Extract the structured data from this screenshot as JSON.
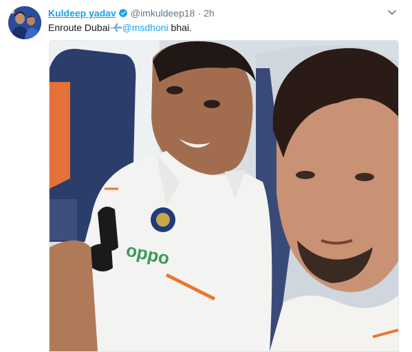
{
  "tweet": {
    "author_name": "Kuldeep yadav",
    "handle": "@imkuldeep18",
    "separator": "·",
    "time": "2h",
    "text_before": "Enroute Dubai",
    "mention": "@msdhoni",
    "text_after": " bhai.",
    "icons": {
      "verified": "verified-badge-icon",
      "caret": "chevron-down-icon",
      "plane": "airplane-emoji-icon"
    },
    "media": {
      "type": "photo",
      "alt": "Selfie of two cricketers in white team jerseys on an airplane"
    }
  },
  "colors": {
    "link": "#1da1f2",
    "meta": "#657786",
    "text": "#14171a"
  }
}
